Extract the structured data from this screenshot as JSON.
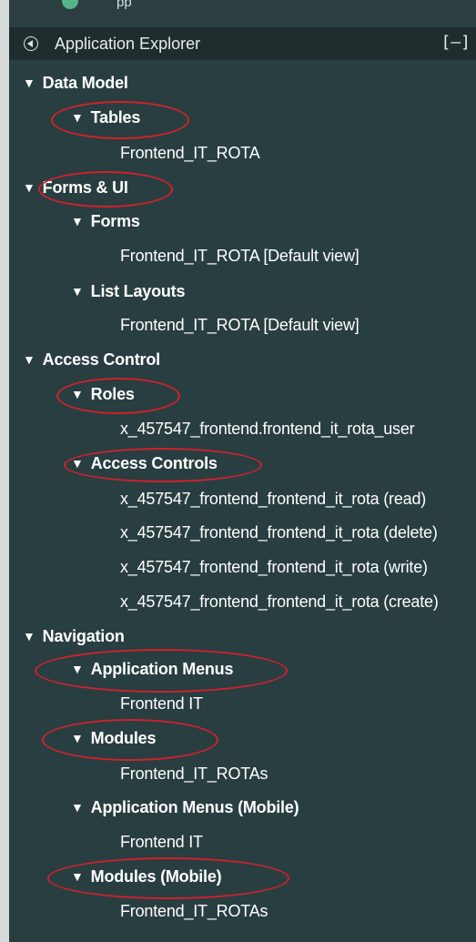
{
  "header": {
    "title": "Application Explorer",
    "collapse_label": "[–]",
    "top_cut_text": "pp"
  },
  "tree": {
    "data_model": "Data Model",
    "tables": "Tables",
    "tables_item": "Frontend_IT_ROTA",
    "forms_ui": "Forms & UI",
    "forms": "Forms",
    "forms_item": "Frontend_IT_ROTA [Default view]",
    "list_layouts": "List Layouts",
    "list_layouts_item": "Frontend_IT_ROTA [Default view]",
    "access_control": "Access Control",
    "roles": "Roles",
    "roles_item": "x_457547_frontend.frontend_it_rota_user",
    "access_controls": "Access Controls",
    "acl_items": [
      "x_457547_frontend_frontend_it_rota (read)",
      "x_457547_frontend_frontend_it_rota (delete)",
      "x_457547_frontend_frontend_it_rota (write)",
      "x_457547_frontend_frontend_it_rota (create)"
    ],
    "navigation": "Navigation",
    "application_menus": "Application Menus",
    "application_menus_item": "Frontend IT",
    "modules": "Modules",
    "modules_item": "Frontend_IT_ROTAs",
    "application_menus_mobile": "Application Menus (Mobile)",
    "application_menus_mobile_item": "Frontend IT",
    "modules_mobile": "Modules (Mobile)",
    "modules_mobile_item": "Frontend_IT_ROTAs"
  },
  "colors": {
    "panel_bg": "#293e40",
    "header_bg": "#1f2d2f",
    "annotation": "#d0212e"
  },
  "icons": {
    "header_back": "circle-left-arrow-icon",
    "expand": "caret-down-icon"
  }
}
